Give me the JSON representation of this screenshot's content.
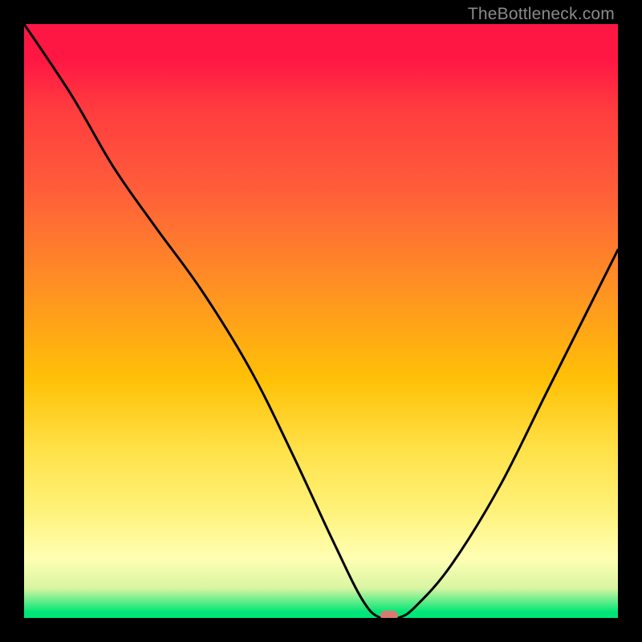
{
  "watermark": "TheBottleneck.com",
  "colors": {
    "frame": "#000000",
    "gradient_top": "#ff1744",
    "gradient_mid1": "#ff9322",
    "gradient_mid2": "#ffe24a",
    "gradient_bottom": "#00e676",
    "curve": "#000000",
    "marker": "#d87a73"
  },
  "chart_data": {
    "type": "line",
    "title": "",
    "xlabel": "",
    "ylabel": "",
    "xlim": [
      0,
      1
    ],
    "ylim": [
      0,
      1
    ],
    "series": [
      {
        "name": "bottleneck-curve",
        "x": [
          0.0,
          0.08,
          0.15,
          0.22,
          0.3,
          0.38,
          0.45,
          0.52,
          0.57,
          0.6,
          0.63,
          0.66,
          0.72,
          0.8,
          0.88,
          0.95,
          1.0
        ],
        "values": [
          1.0,
          0.88,
          0.76,
          0.66,
          0.55,
          0.42,
          0.28,
          0.13,
          0.03,
          0.0,
          0.0,
          0.02,
          0.09,
          0.22,
          0.38,
          0.52,
          0.62
        ]
      }
    ],
    "annotations": [
      {
        "name": "optimal-marker",
        "x": 0.615,
        "y": 0.0
      }
    ]
  }
}
